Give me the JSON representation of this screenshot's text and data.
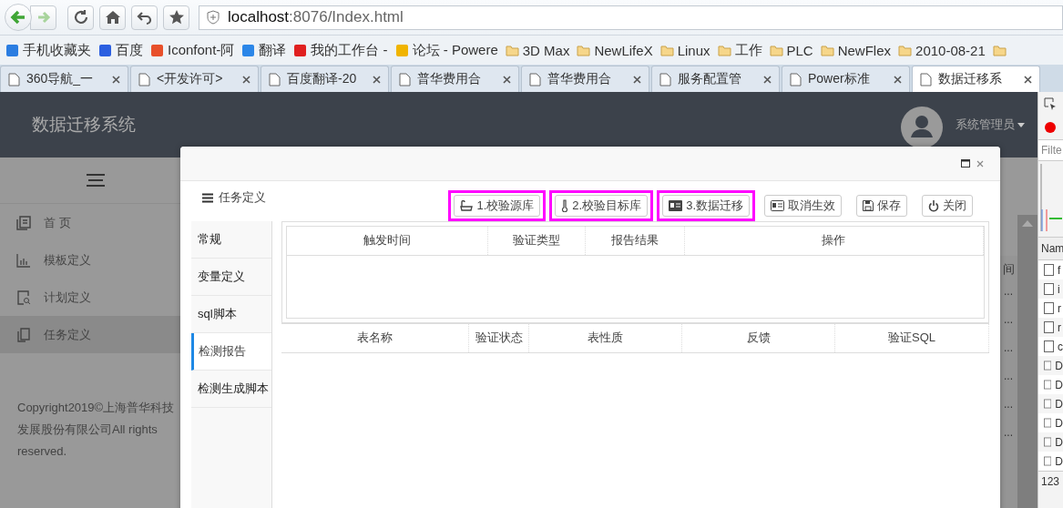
{
  "browser": {
    "address": {
      "host": "localhost",
      "path": ":8076/Index.html"
    },
    "bookmarks": [
      {
        "label": "手机收藏夹",
        "kind": "site"
      },
      {
        "label": "百度",
        "kind": "site"
      },
      {
        "label": "Iconfont-阿",
        "kind": "site"
      },
      {
        "label": "翻译",
        "kind": "site"
      },
      {
        "label": "我的工作台 -",
        "kind": "site"
      },
      {
        "label": "论坛 - Powere",
        "kind": "site"
      },
      {
        "label": "3D Max",
        "kind": "folder"
      },
      {
        "label": "NewLifeX",
        "kind": "folder"
      },
      {
        "label": "Linux",
        "kind": "folder"
      },
      {
        "label": "工作",
        "kind": "folder"
      },
      {
        "label": "PLC",
        "kind": "folder"
      },
      {
        "label": "NewFlex",
        "kind": "folder"
      },
      {
        "label": "2010-08-21",
        "kind": "folder"
      }
    ],
    "tabs": [
      {
        "label": "360导航_一",
        "selected": false
      },
      {
        "label": "<开发许可>",
        "selected": false
      },
      {
        "label": "百度翻译-20",
        "selected": false
      },
      {
        "label": "普华费用合",
        "selected": false
      },
      {
        "label": "普华费用合",
        "selected": false
      },
      {
        "label": "服务配置管",
        "selected": false
      },
      {
        "label": "Power标准",
        "selected": false
      },
      {
        "label": "数据迁移系",
        "selected": true
      }
    ]
  },
  "app": {
    "title": "数据迁移系统",
    "user": "系统管理员",
    "menu": [
      {
        "label": "首 页",
        "selected": false
      },
      {
        "label": "模板定义",
        "selected": false
      },
      {
        "label": "计划定义",
        "selected": false
      },
      {
        "label": "任务定义",
        "selected": true
      }
    ],
    "copyright": "Copyright2019©上海普华科技发展股份有限公司All rights reserved.",
    "background_table": {
      "header": "间",
      "cells": [
        "...",
        "...",
        "...",
        "...",
        "...",
        "..."
      ]
    }
  },
  "dialog": {
    "section_title": "任务定义",
    "buttons": [
      {
        "label": "1.校验源库",
        "highlighted": true
      },
      {
        "label": "2.校验目标库",
        "highlighted": true
      },
      {
        "label": "3.数据迁移",
        "highlighted": true
      },
      {
        "label": "取消生效",
        "highlighted": false
      },
      {
        "label": "保存",
        "highlighted": false
      },
      {
        "label": "关闭",
        "highlighted": false
      }
    ],
    "side_tabs": [
      {
        "label": "常规",
        "selected": false
      },
      {
        "label": "变量定义",
        "selected": false
      },
      {
        "label": "sql脚本",
        "selected": false
      },
      {
        "label": "检测报告",
        "selected": true
      },
      {
        "label": "检测生成脚本",
        "selected": false
      }
    ],
    "report_table": {
      "columns": [
        "触发时间",
        "验证类型",
        "报告结果",
        "操作"
      ]
    },
    "detail_table": {
      "columns": [
        "表名称",
        "验证状态",
        "表性质",
        "反馈",
        "验证SQL"
      ]
    }
  },
  "devtools": {
    "filter_placeholder": "Filte",
    "column": "Nam",
    "rows": [
      "f",
      "i",
      "r",
      "r",
      "c",
      "D",
      "D",
      "D",
      "D",
      "D",
      "D"
    ],
    "footer": "123"
  }
}
